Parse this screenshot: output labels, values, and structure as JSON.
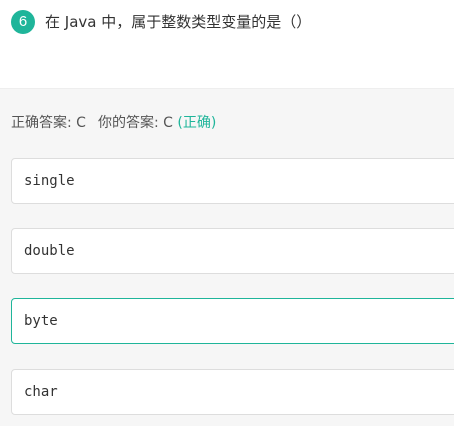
{
  "question": {
    "number": "6",
    "text": "在 Java 中，属于整数类型变量的是（）"
  },
  "answer": {
    "correct_label": "正确答案: C",
    "yours_label": "你的答案: C",
    "result": "(正确)",
    "result_color": "#1fb59a"
  },
  "options": [
    {
      "label": "single",
      "selected": false
    },
    {
      "label": "double",
      "selected": false
    },
    {
      "label": "byte",
      "selected": true
    },
    {
      "label": "char",
      "selected": false
    }
  ],
  "colors": {
    "accent": "#1fb59a",
    "panel_bg": "#f6f6f6"
  }
}
